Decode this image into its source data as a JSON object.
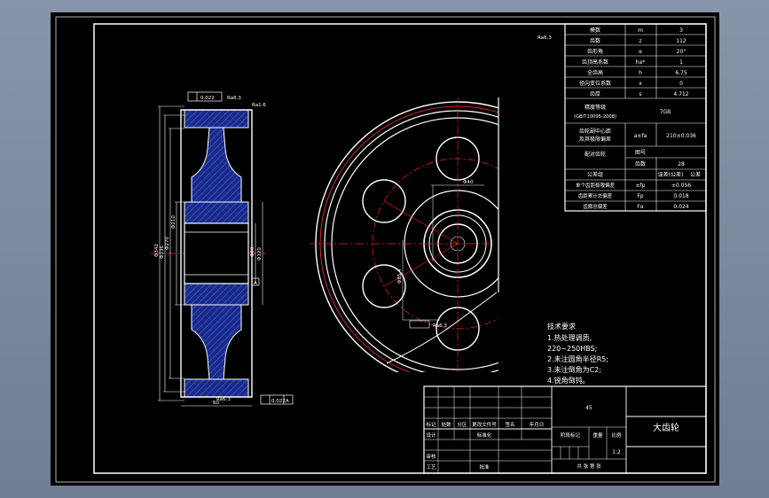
{
  "colors": {
    "window_bg": "#7d8ca1",
    "canvas": "#000000",
    "line": "#ffffff",
    "center_line": "#ff2020",
    "hatch": "#3344aa"
  },
  "params_table": {
    "rows": [
      {
        "label": "模数",
        "symbol": "m",
        "value": "3"
      },
      {
        "label": "齿数",
        "symbol": "z",
        "value": "112"
      },
      {
        "label": "齿形角",
        "symbol": "α",
        "value": "20°"
      },
      {
        "label": "齿顶高系数",
        "symbol": "ha*",
        "value": "1"
      },
      {
        "label": "全齿高",
        "symbol": "h",
        "value": "6.75"
      },
      {
        "label": "径向变位系数",
        "symbol": "x",
        "value": "0"
      },
      {
        "label": "齿厚",
        "symbol": "s",
        "value": "4.712"
      }
    ],
    "precision_label": "精度等级",
    "precision_std": "(GB/T10095-2008)",
    "precision_value": "7GB",
    "center_label_1": "齿轮副中心距",
    "center_label_2": "及其极限偏差",
    "center_symbol": "a±fa",
    "center_value": "210±0.036",
    "pair_label": "配对齿轮",
    "pair_code": "图号",
    "pair_teeth_label": "齿数",
    "pair_teeth_value": "28",
    "tol_group_label": "公差组",
    "tol_group_sub": "误差(公差)",
    "tol_group_val": "公差",
    "pitch_limit_label": "单个齿距极限偏差",
    "pitch_limit_symbol": "±fp",
    "pitch_limit_value": "±0.056",
    "cum_label": "齿距累计总偏差",
    "cum_symbol": "Fp",
    "cum_value": "0.018",
    "profile_label": "齿廓总偏差",
    "profile_symbol": "Fα",
    "profile_value": "0.024"
  },
  "tech_notes": {
    "title": "技术要求",
    "items": [
      "1.热处理调质,",
      "220~250HBS;",
      "2.未注圆角半径R5;",
      "3.未注倒角为C2;",
      "4.锐角倒钝。"
    ]
  },
  "title_block": {
    "part_name": "大齿轮",
    "material": "45",
    "scale_label": "比例",
    "scale": "1:2",
    "weight_label": "重量",
    "stage_label": "阶段标记",
    "h_sign": "标记",
    "h_count": "处数",
    "h_zone": "分区",
    "h_doc": "更改文件号",
    "h_signature": "签名",
    "h_date": "年月日",
    "design": "设计",
    "standardize": "标准化",
    "review": "审核",
    "process": "工艺",
    "approve": "批准",
    "sheet_text": "共 张 第 张"
  },
  "side_view": {
    "dim_da": "Φ342",
    "dim_d": "Φ336",
    "dim_inner1": "Φ270",
    "dim_inner2": "Φ210",
    "dim_bore": "Φ80",
    "dim_hub": "Φ120",
    "dim_width": "60",
    "tol_top": "0.022",
    "tol_bottom": "0.022",
    "datum": "A",
    "rough_top": "Ra6.3",
    "rough_bottom": "Ra6.3",
    "rough_side": "Ra1.6"
  },
  "front_view": {
    "dim_keyway": "Φ85.4",
    "dim_hole": "Φ40",
    "rough_corner": "Ra6.3"
  }
}
